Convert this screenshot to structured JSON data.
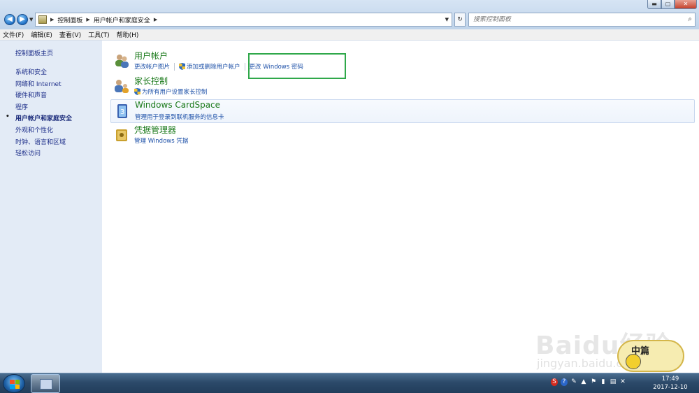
{
  "address_bar": {
    "breadcrumbs": [
      "控制面板",
      "用户帐户和家庭安全"
    ],
    "search_placeholder": "搜索控制面板"
  },
  "menu": [
    "文件(F)",
    "编辑(E)",
    "查看(V)",
    "工具(T)",
    "帮助(H)"
  ],
  "sidebar": {
    "home": "控制面板主页",
    "items": [
      {
        "label": "系统和安全",
        "active": false
      },
      {
        "label": "网络和 Internet",
        "active": false
      },
      {
        "label": "硬件和声音",
        "active": false
      },
      {
        "label": "程序",
        "active": false
      },
      {
        "label": "用户帐户和家庭安全",
        "active": true
      },
      {
        "label": "外观和个性化",
        "active": false
      },
      {
        "label": "时钟、语言和区域",
        "active": false
      },
      {
        "label": "轻松访问",
        "active": false
      }
    ]
  },
  "categories": [
    {
      "title": "用户帐户",
      "links": [
        "更改帐户图片",
        "添加或删除用户帐户",
        "更改 Windows 密码"
      ]
    },
    {
      "title": "家长控制",
      "links": [
        "为所有用户设置家长控制"
      ]
    },
    {
      "title": "Windows CardSpace",
      "links": [
        "管理用于登录到联机服务的信息卡"
      ]
    },
    {
      "title": "凭据管理器",
      "links": [
        "管理 Windows 凭据"
      ]
    }
  ],
  "watermark": {
    "text": "Baidu经验",
    "url": "jingyan.baidu.com",
    "badge": "中篇"
  },
  "taskbar": {
    "time": "17:49",
    "date": "2017-12-10"
  },
  "colors": {
    "accent_green": "#1b7a1b",
    "link_blue": "#1e51a8",
    "highlight_box": "#2fa84a"
  }
}
